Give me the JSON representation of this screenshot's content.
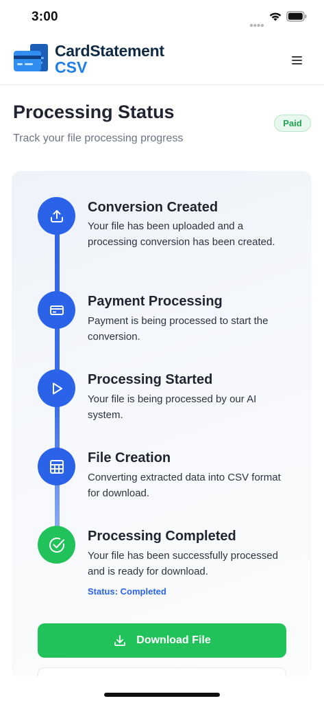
{
  "status_bar": {
    "time": "3:00"
  },
  "header": {
    "brand_line1": "CardStatement",
    "brand_line2": "CSV",
    "logo_icon": "card-statement-logo-icon",
    "menu_icon": "hamburger-menu-icon"
  },
  "page": {
    "title": "Processing Status",
    "subtitle": "Track your file processing progress",
    "badge": "Paid"
  },
  "steps": [
    {
      "title": "Conversion Created",
      "description": "Your file has been uploaded and a processing conversion has been created.",
      "icon": "upload-icon",
      "state": "complete"
    },
    {
      "title": "Payment Processing",
      "description": "Payment is being processed to start the conversion.",
      "icon": "credit-card-icon",
      "state": "complete"
    },
    {
      "title": "Processing Started",
      "description": "Your file is being processed by our AI system.",
      "icon": "play-icon",
      "state": "complete"
    },
    {
      "title": "File Creation",
      "description": "Converting extracted data into CSV format for download.",
      "icon": "table-icon",
      "state": "complete"
    },
    {
      "title": "Processing Completed",
      "description": "Your file has been successfully processed and is ready for download.",
      "icon": "check-circle-icon",
      "state": "complete"
    }
  ],
  "status_label": "Status: Completed",
  "actions": {
    "download_label": "Download File",
    "download_icon": "download-icon"
  },
  "colors": {
    "accent_blue": "#2a62e8",
    "success_green": "#22c25a",
    "brand_dark": "#0f2a44",
    "brand_blue": "#1f7ee8"
  }
}
